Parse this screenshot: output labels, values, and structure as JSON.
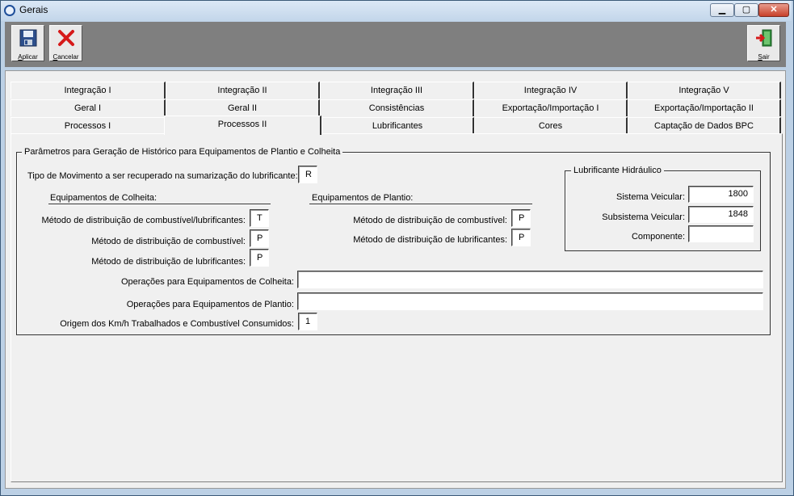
{
  "window": {
    "title": "Gerais",
    "minimize": "▁",
    "maximize": "▢",
    "close": "✕"
  },
  "toolbar": {
    "aplicar": {
      "label": "Aplicar",
      "icon": "floppy-disk-icon"
    },
    "cancelar": {
      "label": "Cancelar",
      "icon": "red-x-icon"
    },
    "sair": {
      "label": "Sair",
      "icon": "exit-door-icon"
    }
  },
  "tabs": {
    "row1": [
      "Integração I",
      "Integração II",
      "Integração III",
      "Integração IV",
      "Integração V"
    ],
    "row2": [
      "Geral I",
      "Geral II",
      "Consistências",
      "Exportação/Importação I",
      "Exportação/Importação II"
    ],
    "row3": [
      "Processos I",
      "Processos II",
      "Lubrificantes",
      "Cores",
      "Captação de Dados BPC"
    ],
    "active": "Processos II"
  },
  "group": {
    "title": "Parâmetros para Geração de Histórico para Equipamentos de Plantio e Colheita",
    "tipo_movimento_label": "Tipo de Movimento a ser recuperado na sumarização do lubrificante:",
    "tipo_movimento_value": "R",
    "colheita": {
      "header": "Equipamentos de Colheita:",
      "comb_lub_label": "Método de distribuição de combustível/lubrificantes:",
      "comb_lub_value": "T",
      "comb_label": "Método de distribuição de combustível:",
      "comb_value": "P",
      "lub_label": "Método de distribuição de lubrificantes:",
      "lub_value": "P"
    },
    "plantio": {
      "header": "Equipamentos de Plantio:",
      "comb_label": "Método de distribuição de combustível:",
      "comb_value": "P",
      "lub_label": "Método de distribuição de lubrificantes:",
      "lub_value": "P"
    },
    "hidraulico": {
      "title": "Lubrificante Hidráulico",
      "sistema_label": "Sistema Veicular:",
      "sistema_value": "1800",
      "subsistema_label": "Subsistema Veicular:",
      "subsistema_value": "1848",
      "componente_label": "Componente:",
      "componente_value": ""
    },
    "op_colheita_label": "Operações para Equipamentos de Colheita:",
    "op_colheita_value": "",
    "op_plantio_label": "Operações para Equipamentos de Plantio:",
    "op_plantio_value": "",
    "origem_label": "Origem dos Km/h Trabalhados e Combustível Consumidos:",
    "origem_value": "1"
  }
}
